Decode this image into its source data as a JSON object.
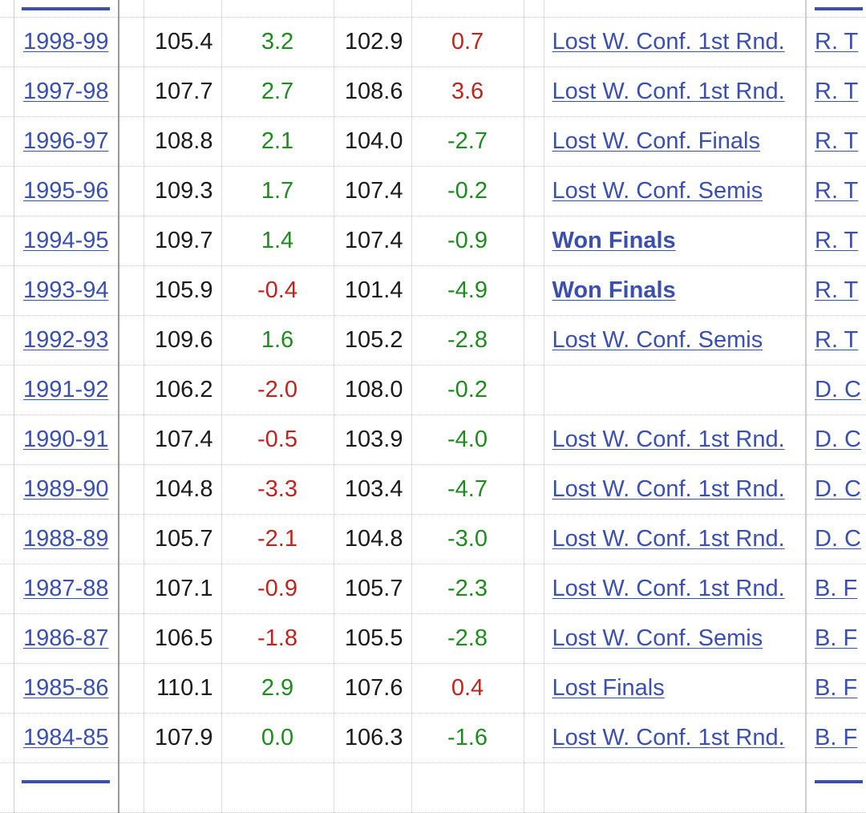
{
  "rows": [
    {
      "season": "",
      "ortg": "",
      "ortg_rel": "",
      "drtg": "",
      "drtg_rel": "",
      "playoffs": "",
      "coach": "",
      "partial": true
    },
    {
      "season": "1998-99",
      "ortg": "105.4",
      "ortg_rel": "3.2",
      "drtg": "102.9",
      "drtg_rel": "0.7",
      "playoffs": "Lost W. Conf. 1st Rnd.",
      "playoffs_won": false,
      "coach": "R. T"
    },
    {
      "season": "1997-98",
      "ortg": "107.7",
      "ortg_rel": "2.7",
      "drtg": "108.6",
      "drtg_rel": "3.6",
      "playoffs": "Lost W. Conf. 1st Rnd.",
      "playoffs_won": false,
      "coach": "R. T"
    },
    {
      "season": "1996-97",
      "ortg": "108.8",
      "ortg_rel": "2.1",
      "drtg": "104.0",
      "drtg_rel": "-2.7",
      "playoffs": "Lost W. Conf. Finals",
      "playoffs_won": false,
      "coach": "R. T"
    },
    {
      "season": "1995-96",
      "ortg": "109.3",
      "ortg_rel": "1.7",
      "drtg": "107.4",
      "drtg_rel": "-0.2",
      "playoffs": "Lost W. Conf. Semis",
      "playoffs_won": false,
      "coach": "R. T"
    },
    {
      "season": "1994-95",
      "ortg": "109.7",
      "ortg_rel": "1.4",
      "drtg": "107.4",
      "drtg_rel": "-0.9",
      "playoffs": "Won Finals",
      "playoffs_won": true,
      "coach": "R. T"
    },
    {
      "season": "1993-94",
      "ortg": "105.9",
      "ortg_rel": "-0.4",
      "drtg": "101.4",
      "drtg_rel": "-4.9",
      "playoffs": "Won Finals",
      "playoffs_won": true,
      "coach": "R. T"
    },
    {
      "season": "1992-93",
      "ortg": "109.6",
      "ortg_rel": "1.6",
      "drtg": "105.2",
      "drtg_rel": "-2.8",
      "playoffs": "Lost W. Conf. Semis",
      "playoffs_won": false,
      "coach": "R. T"
    },
    {
      "season": "1991-92",
      "ortg": "106.2",
      "ortg_rel": "-2.0",
      "drtg": "108.0",
      "drtg_rel": "-0.2",
      "playoffs": "",
      "playoffs_won": false,
      "coach": "D. C"
    },
    {
      "season": "1990-91",
      "ortg": "107.4",
      "ortg_rel": "-0.5",
      "drtg": "103.9",
      "drtg_rel": "-4.0",
      "playoffs": "Lost W. Conf. 1st Rnd.",
      "playoffs_won": false,
      "coach": "D. C"
    },
    {
      "season": "1989-90",
      "ortg": "104.8",
      "ortg_rel": "-3.3",
      "drtg": "103.4",
      "drtg_rel": "-4.7",
      "playoffs": "Lost W. Conf. 1st Rnd.",
      "playoffs_won": false,
      "coach": "D. C"
    },
    {
      "season": "1988-89",
      "ortg": "105.7",
      "ortg_rel": "-2.1",
      "drtg": "104.8",
      "drtg_rel": "-3.0",
      "playoffs": "Lost W. Conf. 1st Rnd.",
      "playoffs_won": false,
      "coach": "D. C"
    },
    {
      "season": "1987-88",
      "ortg": "107.1",
      "ortg_rel": "-0.9",
      "drtg": "105.7",
      "drtg_rel": "-2.3",
      "playoffs": "Lost W. Conf. 1st Rnd.",
      "playoffs_won": false,
      "coach": "B. F"
    },
    {
      "season": "1986-87",
      "ortg": "106.5",
      "ortg_rel": "-1.8",
      "drtg": "105.5",
      "drtg_rel": "-2.8",
      "playoffs": "Lost W. Conf. Semis",
      "playoffs_won": false,
      "coach": "B. F"
    },
    {
      "season": "1985-86",
      "ortg": "110.1",
      "ortg_rel": "2.9",
      "drtg": "107.6",
      "drtg_rel": "0.4",
      "playoffs": "Lost Finals",
      "playoffs_won": false,
      "coach": "B. F"
    },
    {
      "season": "1984-85",
      "ortg": "107.9",
      "ortg_rel": "0.0",
      "drtg": "106.3",
      "drtg_rel": "-1.6",
      "playoffs": "Lost W. Conf. 1st Rnd.",
      "playoffs_won": false,
      "coach": "B. F"
    },
    {
      "season": "",
      "ortg": "",
      "ortg_rel": "",
      "drtg": "",
      "drtg_rel": "",
      "playoffs": "",
      "coach": "",
      "partial": true
    }
  ],
  "colors": {
    "link": "#3a4fb0",
    "positive": "#1f8a1f",
    "negative": "#c0241e",
    "text": "#1a1a1a"
  }
}
